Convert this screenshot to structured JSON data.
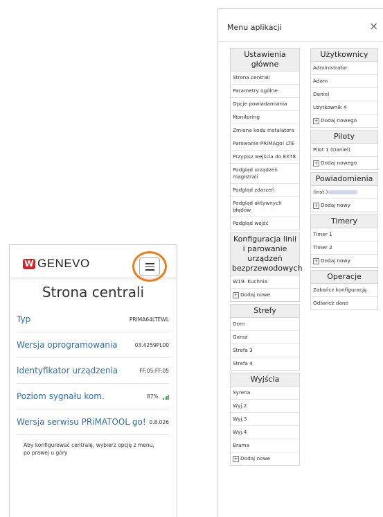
{
  "phone": {
    "brand": "GENEVO",
    "brand_mark": "W",
    "page_title": "Strona centrali",
    "rows": [
      {
        "label": "Typ",
        "value": "PRIMA64LTEWL"
      },
      {
        "label": "Wersja oprogramowania",
        "value": "03.4259PL00"
      },
      {
        "label": "Identyfikator urządzenia",
        "value": "FF:05:FF:05"
      },
      {
        "label": "Poziom sygnału kom.",
        "value": "87%",
        "signal_icon": "signal-bars-icon"
      },
      {
        "label": "Wersja serwisu PRiMATOOL go!",
        "value": "0.8.026"
      }
    ],
    "hint": "Aby konfigurować centralę, wybierz opcję z menu, po prawej u góry",
    "accent_color": "#2f6fa7",
    "highlight_color": "#f07c1b"
  },
  "menu": {
    "title": "Menu aplikacji",
    "close": "×",
    "left": [
      {
        "head": "Ustawienia główne",
        "items": [
          "Strona centrali",
          "Parametry ogólne",
          "Opcje powiadamiania",
          "Monitoring",
          "Zmiana kodu instalatora",
          "Parowanie PRiMAgo! LTE",
          "Przypisz wejścia do EXT8",
          "Podgląd urządzeń magistrali",
          "Podgląd zdarzeń",
          "Podgląd aktywnych błędów",
          "Podgląd wejść"
        ]
      },
      {
        "head": "Konfiguracja linii i parowanie urządzeń bezprzewodowych",
        "items": [
          "W19: Kuchnia"
        ],
        "add": "Dodaj nowe"
      },
      {
        "head": "Strefy",
        "items": [
          "Dom",
          "Garaż",
          "Strefa 3",
          "Strefa 4"
        ]
      },
      {
        "head": "Wyjścia",
        "items": [
          "Syrena",
          "Wyj.2",
          "Wyj.3",
          "Wyj.4",
          "Brama"
        ],
        "add": "Dodaj nowe"
      }
    ],
    "right": [
      {
        "head": "Użytkownicy",
        "items": [
          "Administrator",
          "Adam",
          "Daniel",
          "Użytkownik 4"
        ],
        "add": "Dodaj nowego"
      },
      {
        "head": "Piloty",
        "items": [
          "Pilot 1 (Daniel)"
        ],
        "add": "Dodaj nowego"
      },
      {
        "head": "Powiadomienia",
        "items": [
          "(inst.)"
        ],
        "add": "Dodaj nowy"
      },
      {
        "head": "Timery",
        "items": [
          "Timer 1",
          "Timer 2"
        ],
        "add": "Dodaj nowy"
      },
      {
        "head": "Operacje",
        "items": [
          "Zakończ konfigurację",
          "Odśwież dane"
        ]
      }
    ]
  }
}
